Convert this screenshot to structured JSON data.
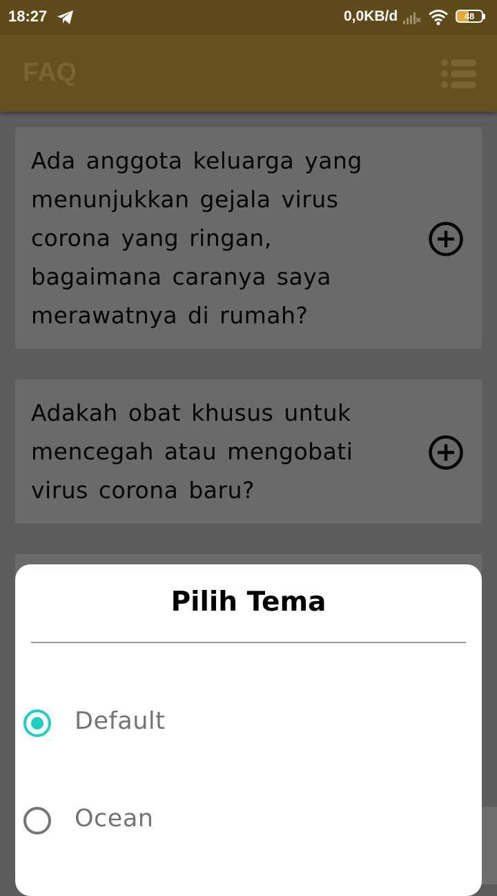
{
  "status_bar": {
    "time": "18:27",
    "data_speed": "0,0KB/d",
    "battery_level": "48",
    "icons": [
      "telegram-icon",
      "signal-icon",
      "wifi-icon",
      "battery-icon"
    ]
  },
  "app_bar": {
    "title": "FAQ",
    "menu_icon": "menu-icon"
  },
  "faq": {
    "items": [
      {
        "question": "Ada anggota keluarga yang menunjukkan gejala virus corona yang ringan, bagaimana caranya saya merawatnya di rumah?",
        "icon": "plus-circle-icon"
      },
      {
        "question": "Adakah obat khusus untuk mencegah atau mengobati virus corona baru?",
        "icon": "plus-circle-icon"
      }
    ]
  },
  "theme_dialog": {
    "title": "Pilih Tema",
    "options": [
      {
        "label": "Default",
        "selected": true
      },
      {
        "label": "Ocean",
        "selected": false
      }
    ]
  },
  "colors": {
    "status_bar": "#5f4a1c",
    "app_bar": "#665020",
    "card": "#6a6a6a",
    "accent": "#1fcfc4",
    "battery": "#e4a93a"
  }
}
